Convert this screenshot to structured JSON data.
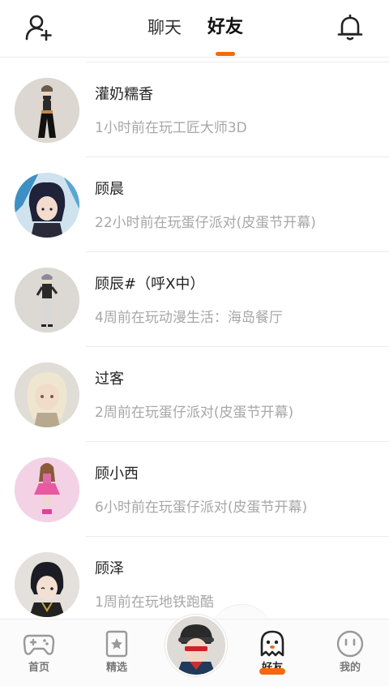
{
  "header": {
    "tabs": [
      {
        "label": "聊天",
        "active": false
      },
      {
        "label": "好友",
        "active": true
      }
    ],
    "add_friend_icon": "add-user-icon",
    "notification_icon": "bell-icon",
    "accent_color": "#f26a10"
  },
  "friends": [
    {
      "name": "灌奶糯香",
      "status": "1小时前在玩工匠大师3D"
    },
    {
      "name": "顾晨",
      "status": "22小时前在玩蛋仔派对(皮蛋节开幕)"
    },
    {
      "name": "顾辰#（呼X中）",
      "status": "4周前在玩动漫生活：海岛餐厅"
    },
    {
      "name": "过客",
      "status": "2周前在玩蛋仔派对(皮蛋节开幕)"
    },
    {
      "name": "顾小西",
      "status": "6小时前在玩蛋仔派对(皮蛋节开幕)"
    },
    {
      "name": "顾泽",
      "status": "1周前在玩地铁跑酷"
    }
  ],
  "tabbar": {
    "items": [
      {
        "label": "首页",
        "icon": "gamepad-icon",
        "active": false
      },
      {
        "label": "精选",
        "icon": "star-card-icon",
        "active": false
      },
      {
        "label": "好友",
        "icon": "ghost-icon",
        "active": true
      },
      {
        "label": "我的",
        "icon": "smiley-icon",
        "active": false
      }
    ]
  }
}
